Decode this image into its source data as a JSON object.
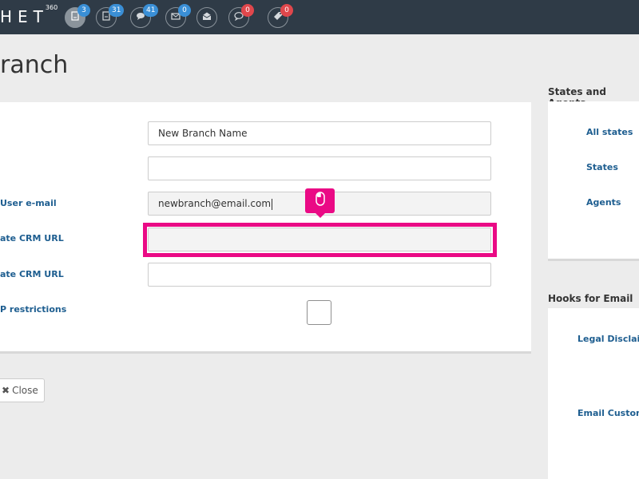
{
  "header": {
    "logo_text": "HET",
    "logo_sup": "360",
    "nav_icons": [
      {
        "name": "reports-icon",
        "badge": "3",
        "badge_color": "#3a8fd6",
        "active": true
      },
      {
        "name": "documents-icon",
        "badge": "31",
        "badge_color": "#3a8fd6",
        "active": false
      },
      {
        "name": "chat-icon",
        "badge": "41",
        "badge_color": "#3a8fd6",
        "active": false
      },
      {
        "name": "mail-icon",
        "badge": "0",
        "badge_color": "#3a8fd6",
        "active": false
      },
      {
        "name": "open-mail-icon",
        "badge": "",
        "badge_color": "",
        "active": false
      },
      {
        "name": "comment-icon",
        "badge": "0",
        "badge_color": "#e0474c",
        "active": false
      },
      {
        "name": "tag-icon",
        "badge": "0",
        "badge_color": "#e0474c",
        "active": false
      }
    ]
  },
  "page": {
    "title": "ranch"
  },
  "form": {
    "name_value": "New Branch Name",
    "second_value": "",
    "email_label": "User e-mail",
    "email_value": "newbranch@email.com",
    "crm_url_label_1": "ate CRM URL",
    "crm_url_value_1": "",
    "crm_url_label_2": "ate CRM URL",
    "crm_url_value_2": "",
    "restrictions_label": "P restrictions"
  },
  "actions": {
    "close_label": "Close"
  },
  "sidebar": {
    "states_heading": "States and Agents",
    "states_links": [
      "All states",
      "States",
      "Agents"
    ],
    "hooks_heading": "Hooks for Email",
    "hooks_links": [
      "Legal Disclaim",
      "Email Custom"
    ]
  },
  "colors": {
    "accent": "#ea0a85",
    "topbar": "#2f3b47",
    "link": "#1e5e90"
  }
}
